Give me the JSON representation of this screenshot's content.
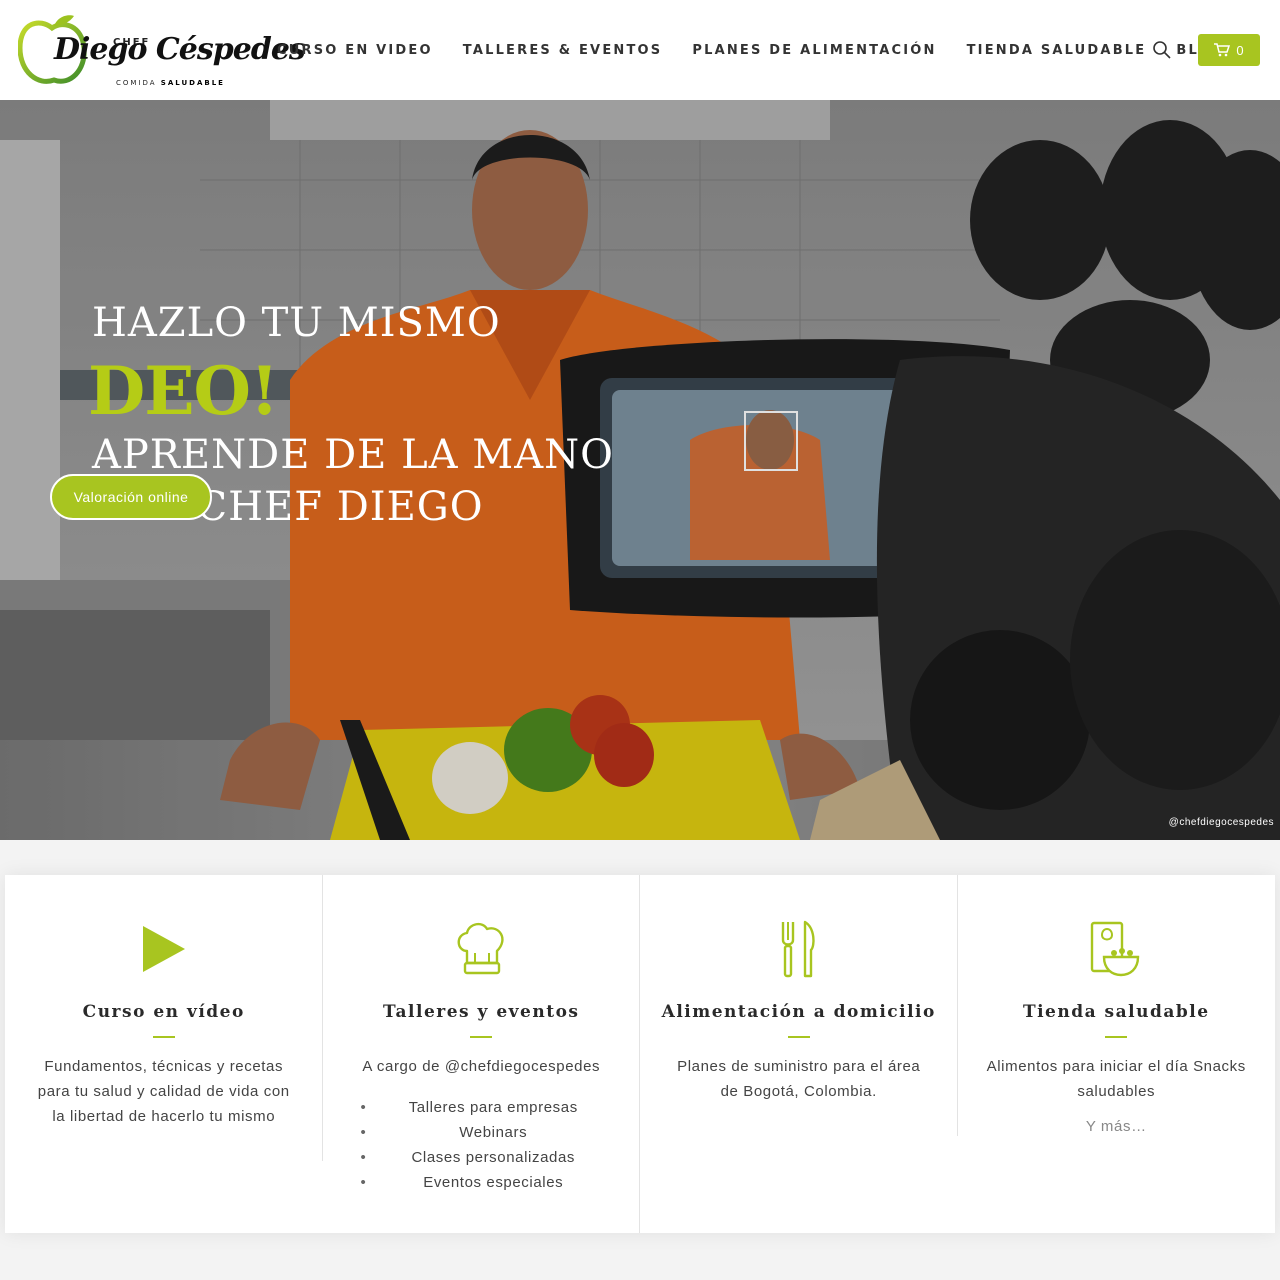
{
  "brand": {
    "chef": "CHEF",
    "name": "Diego Céspedes",
    "sub_prefix": "COMIDA",
    "sub_bold": "SALUDABLE"
  },
  "nav": [
    "CURSO EN VIDEO",
    "TALLERES & EVENTOS",
    "PLANES DE ALIMENTACIÓN",
    "TIENDA SALUDABLE",
    "BLOG"
  ],
  "cart": {
    "count": "0"
  },
  "hero": {
    "line1": "HAZLO TU MISMO",
    "line2": "DEO!",
    "line3": "APRENDE DE LA MANO",
    "line4": "DEL CHEF DIEGO",
    "button": "Valoración online",
    "credit": "@chefdiegocespedes"
  },
  "features": [
    {
      "icon": "play-icon",
      "title": "Curso en vídeo",
      "text": "Fundamentos, técnicas y recetas para tu salud y calidad de vida con la libertad de hacerlo tu mismo"
    },
    {
      "icon": "chef-hat-icon",
      "title": "Talleres y eventos",
      "text": "A cargo de @chefdiegocespedes",
      "list": [
        "Talleres para empresas",
        "Webinars",
        "Clases personalizadas",
        "Eventos especiales"
      ]
    },
    {
      "icon": "fork-knife-icon",
      "title": "Alimentación a domicilio",
      "text": "Planes de suministro para el área de Bogotá, Colombia."
    },
    {
      "icon": "recipe-bowl-icon",
      "title": "Tienda saludable",
      "text": "Alimentos para iniciar el día Snacks saludables",
      "more": "Y más…"
    }
  ],
  "colors": {
    "accent": "#a8c520",
    "hero_green": "#b5cc16"
  }
}
